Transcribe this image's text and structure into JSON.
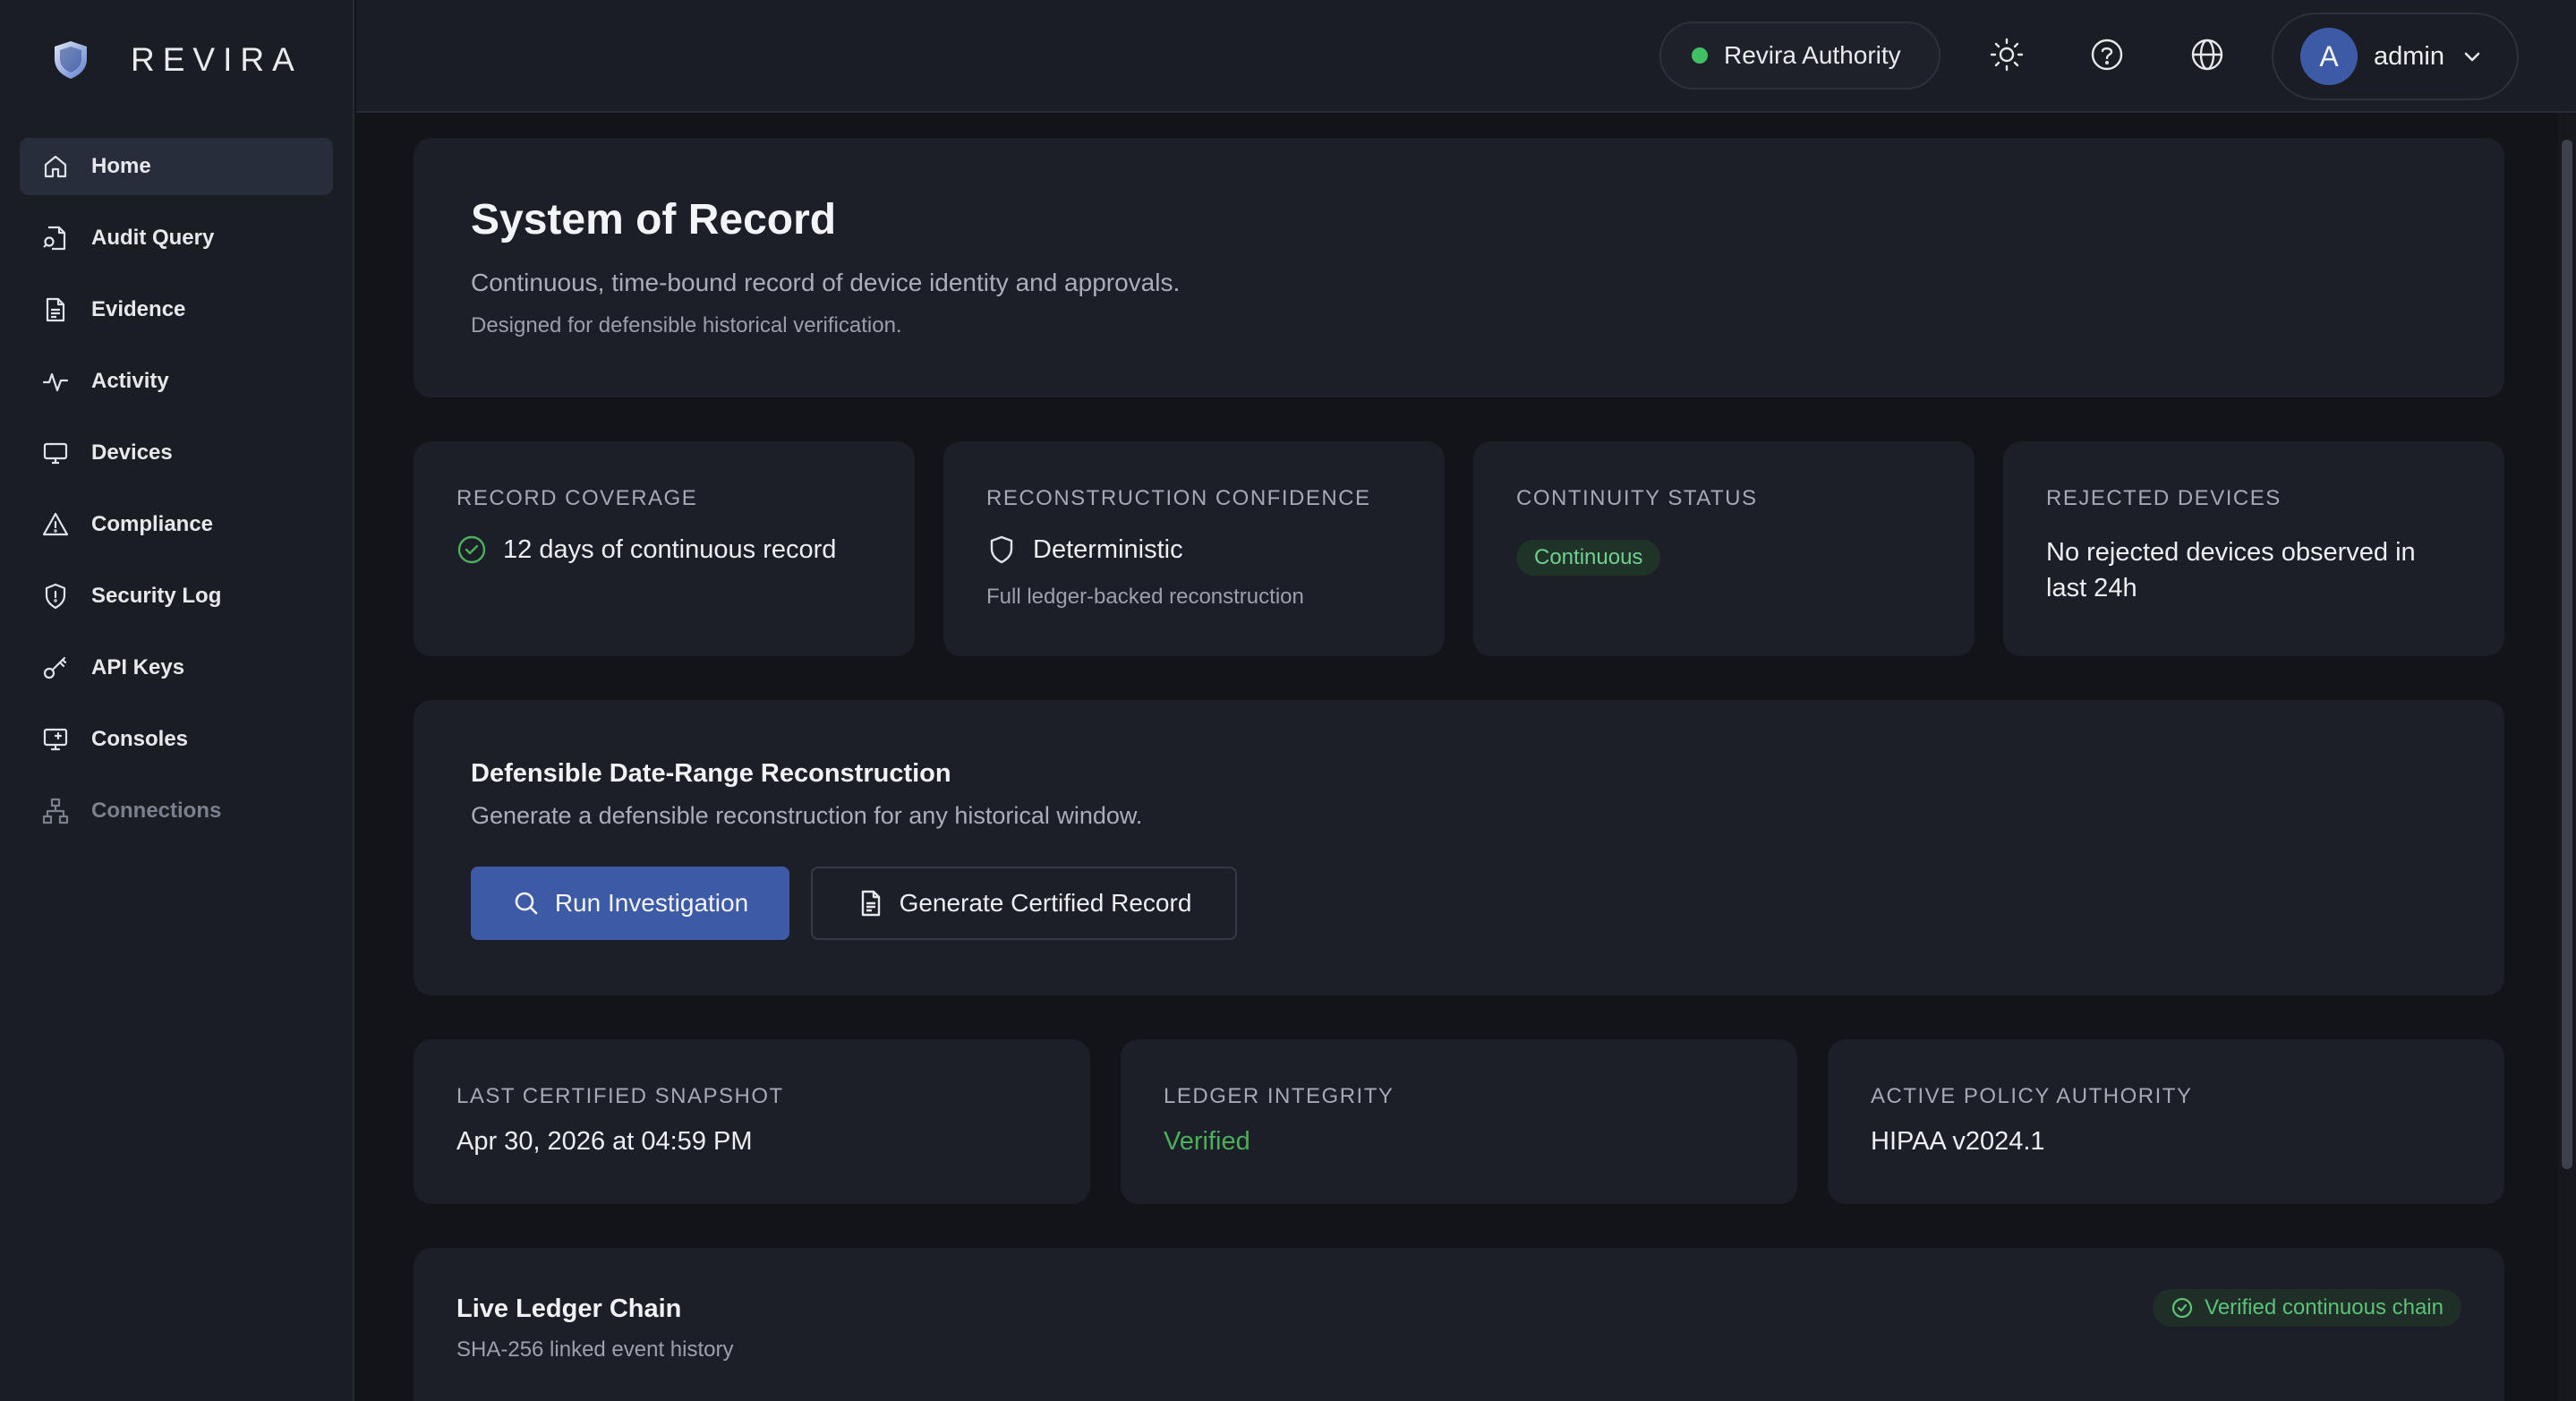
{
  "brand": {
    "name": "REVIRA",
    "logo_icon": "shield-logo"
  },
  "sidebar": {
    "items": [
      {
        "label": "Home",
        "icon": "home-icon",
        "active": true
      },
      {
        "label": "Audit Query",
        "icon": "file-search-icon"
      },
      {
        "label": "Evidence",
        "icon": "document-icon"
      },
      {
        "label": "Activity",
        "icon": "activity-icon"
      },
      {
        "label": "Devices",
        "icon": "monitor-icon"
      },
      {
        "label": "Compliance",
        "icon": "warning-icon"
      },
      {
        "label": "Security Log",
        "icon": "shield-icon"
      },
      {
        "label": "API Keys",
        "icon": "key-icon"
      },
      {
        "label": "Consoles",
        "icon": "console-icon"
      },
      {
        "label": "Connections",
        "icon": "network-icon",
        "disabled": true
      }
    ]
  },
  "header": {
    "authority": "Revira Authority",
    "authority_status_color": "#3fc063",
    "icons": [
      "sun-icon",
      "help-icon",
      "globe-icon"
    ],
    "user": {
      "initial": "A",
      "name": "admin"
    }
  },
  "hero": {
    "title": "System of Record",
    "subtitle": "Continuous, time-bound record of device identity and approvals.",
    "note": "Designed for defensible historical verification."
  },
  "stats": {
    "coverage": {
      "label": "Record Coverage",
      "value": "12 days of continuous record"
    },
    "confidence": {
      "label": "Reconstruction Confidence",
      "value": "Deterministic",
      "note": "Full ledger-backed reconstruction"
    },
    "continuity": {
      "label": "Continuity Status",
      "badge": "Continuous"
    },
    "rejected": {
      "label": "Rejected Devices",
      "value": "No rejected devices observed in last 24h"
    }
  },
  "reconstruction": {
    "title": "Defensible Date-Range Reconstruction",
    "subtitle": "Generate a defensible reconstruction for any historical window.",
    "primary_button": "Run Investigation",
    "secondary_button": "Generate Certified Record"
  },
  "snapshot": {
    "last": {
      "label": "Last Certified Snapshot",
      "value": "Apr 30, 2026 at 04:59 PM"
    },
    "integrity": {
      "label": "Ledger Integrity",
      "value": "Verified"
    },
    "policy": {
      "label": "Active Policy Authority",
      "value": "HIPAA v2024.1"
    }
  },
  "ledger": {
    "title": "Live Ledger Chain",
    "subtitle": "SHA-256 linked event history",
    "status": "Verified continuous chain"
  },
  "colors": {
    "accent": "#3d5aa6",
    "success": "#4caf5c",
    "background": "#121419",
    "card": "#1c1f27"
  }
}
